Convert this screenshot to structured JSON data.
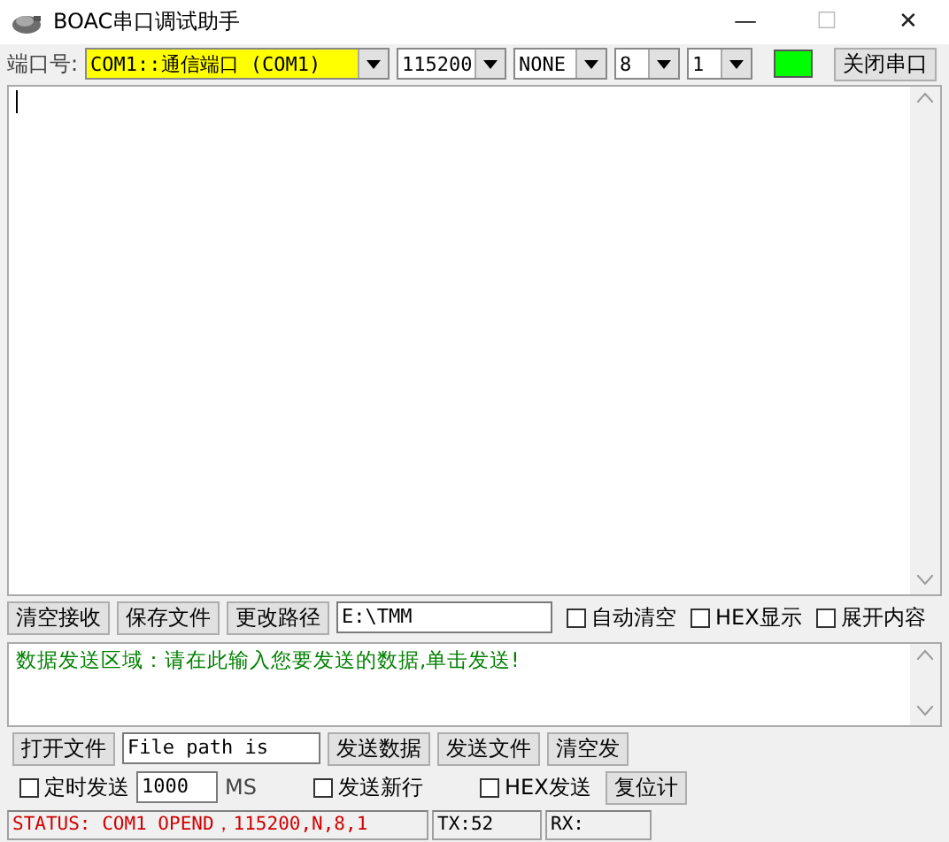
{
  "window": {
    "title": "BOAC串口调试助手",
    "controls": [
      "—",
      "☐",
      "✕"
    ]
  },
  "port_bar": {
    "label": "端口号:",
    "selects": [
      {
        "value": "COM1::通信端口 (COM1)",
        "highlighted": true
      },
      {
        "value": "115200",
        "highlighted": false
      },
      {
        "value": "NONE",
        "highlighted": false
      },
      {
        "value": "8",
        "highlighted": false
      },
      {
        "value": "1",
        "highlighted": false
      }
    ],
    "indicator": {
      "on": true
    },
    "button": "关闭串口"
  },
  "receive_bar": {
    "buttons": [
      "清空接收",
      "保存文件",
      "更改路径"
    ],
    "path": "E:\\TMM",
    "checkboxes": [
      {
        "label": "自动清空",
        "checked": false
      },
      {
        "label": "HEX显示",
        "checked": false
      },
      {
        "label": "展开内容",
        "checked": false
      }
    ]
  },
  "send_area": {
    "text": "数据发送区域：请在此输入您要发送的数据,单击发送!"
  },
  "send_row1": {
    "button": "打开文件",
    "file_path": "File path is",
    "buttons": [
      "发送数据",
      "发送文件",
      "清空发"
    ]
  },
  "send_row2": {
    "items": [
      {
        "kind": "checkbox",
        "label": "定时发送",
        "checked": false
      },
      {
        "kind": "field",
        "value": "1000"
      },
      {
        "kind": "label",
        "text": "MS"
      },
      {
        "kind": "checkbox",
        "label": "发送新行",
        "checked": false
      },
      {
        "kind": "checkbox",
        "label": "HEX发送",
        "checked": false
      },
      {
        "kind": "button",
        "label": "复位计"
      }
    ]
  },
  "status_bar": {
    "status": "STATUS: COM1 OPEND，115200,N,8,1",
    "tx": "TX:52",
    "rx": "RX:"
  }
}
